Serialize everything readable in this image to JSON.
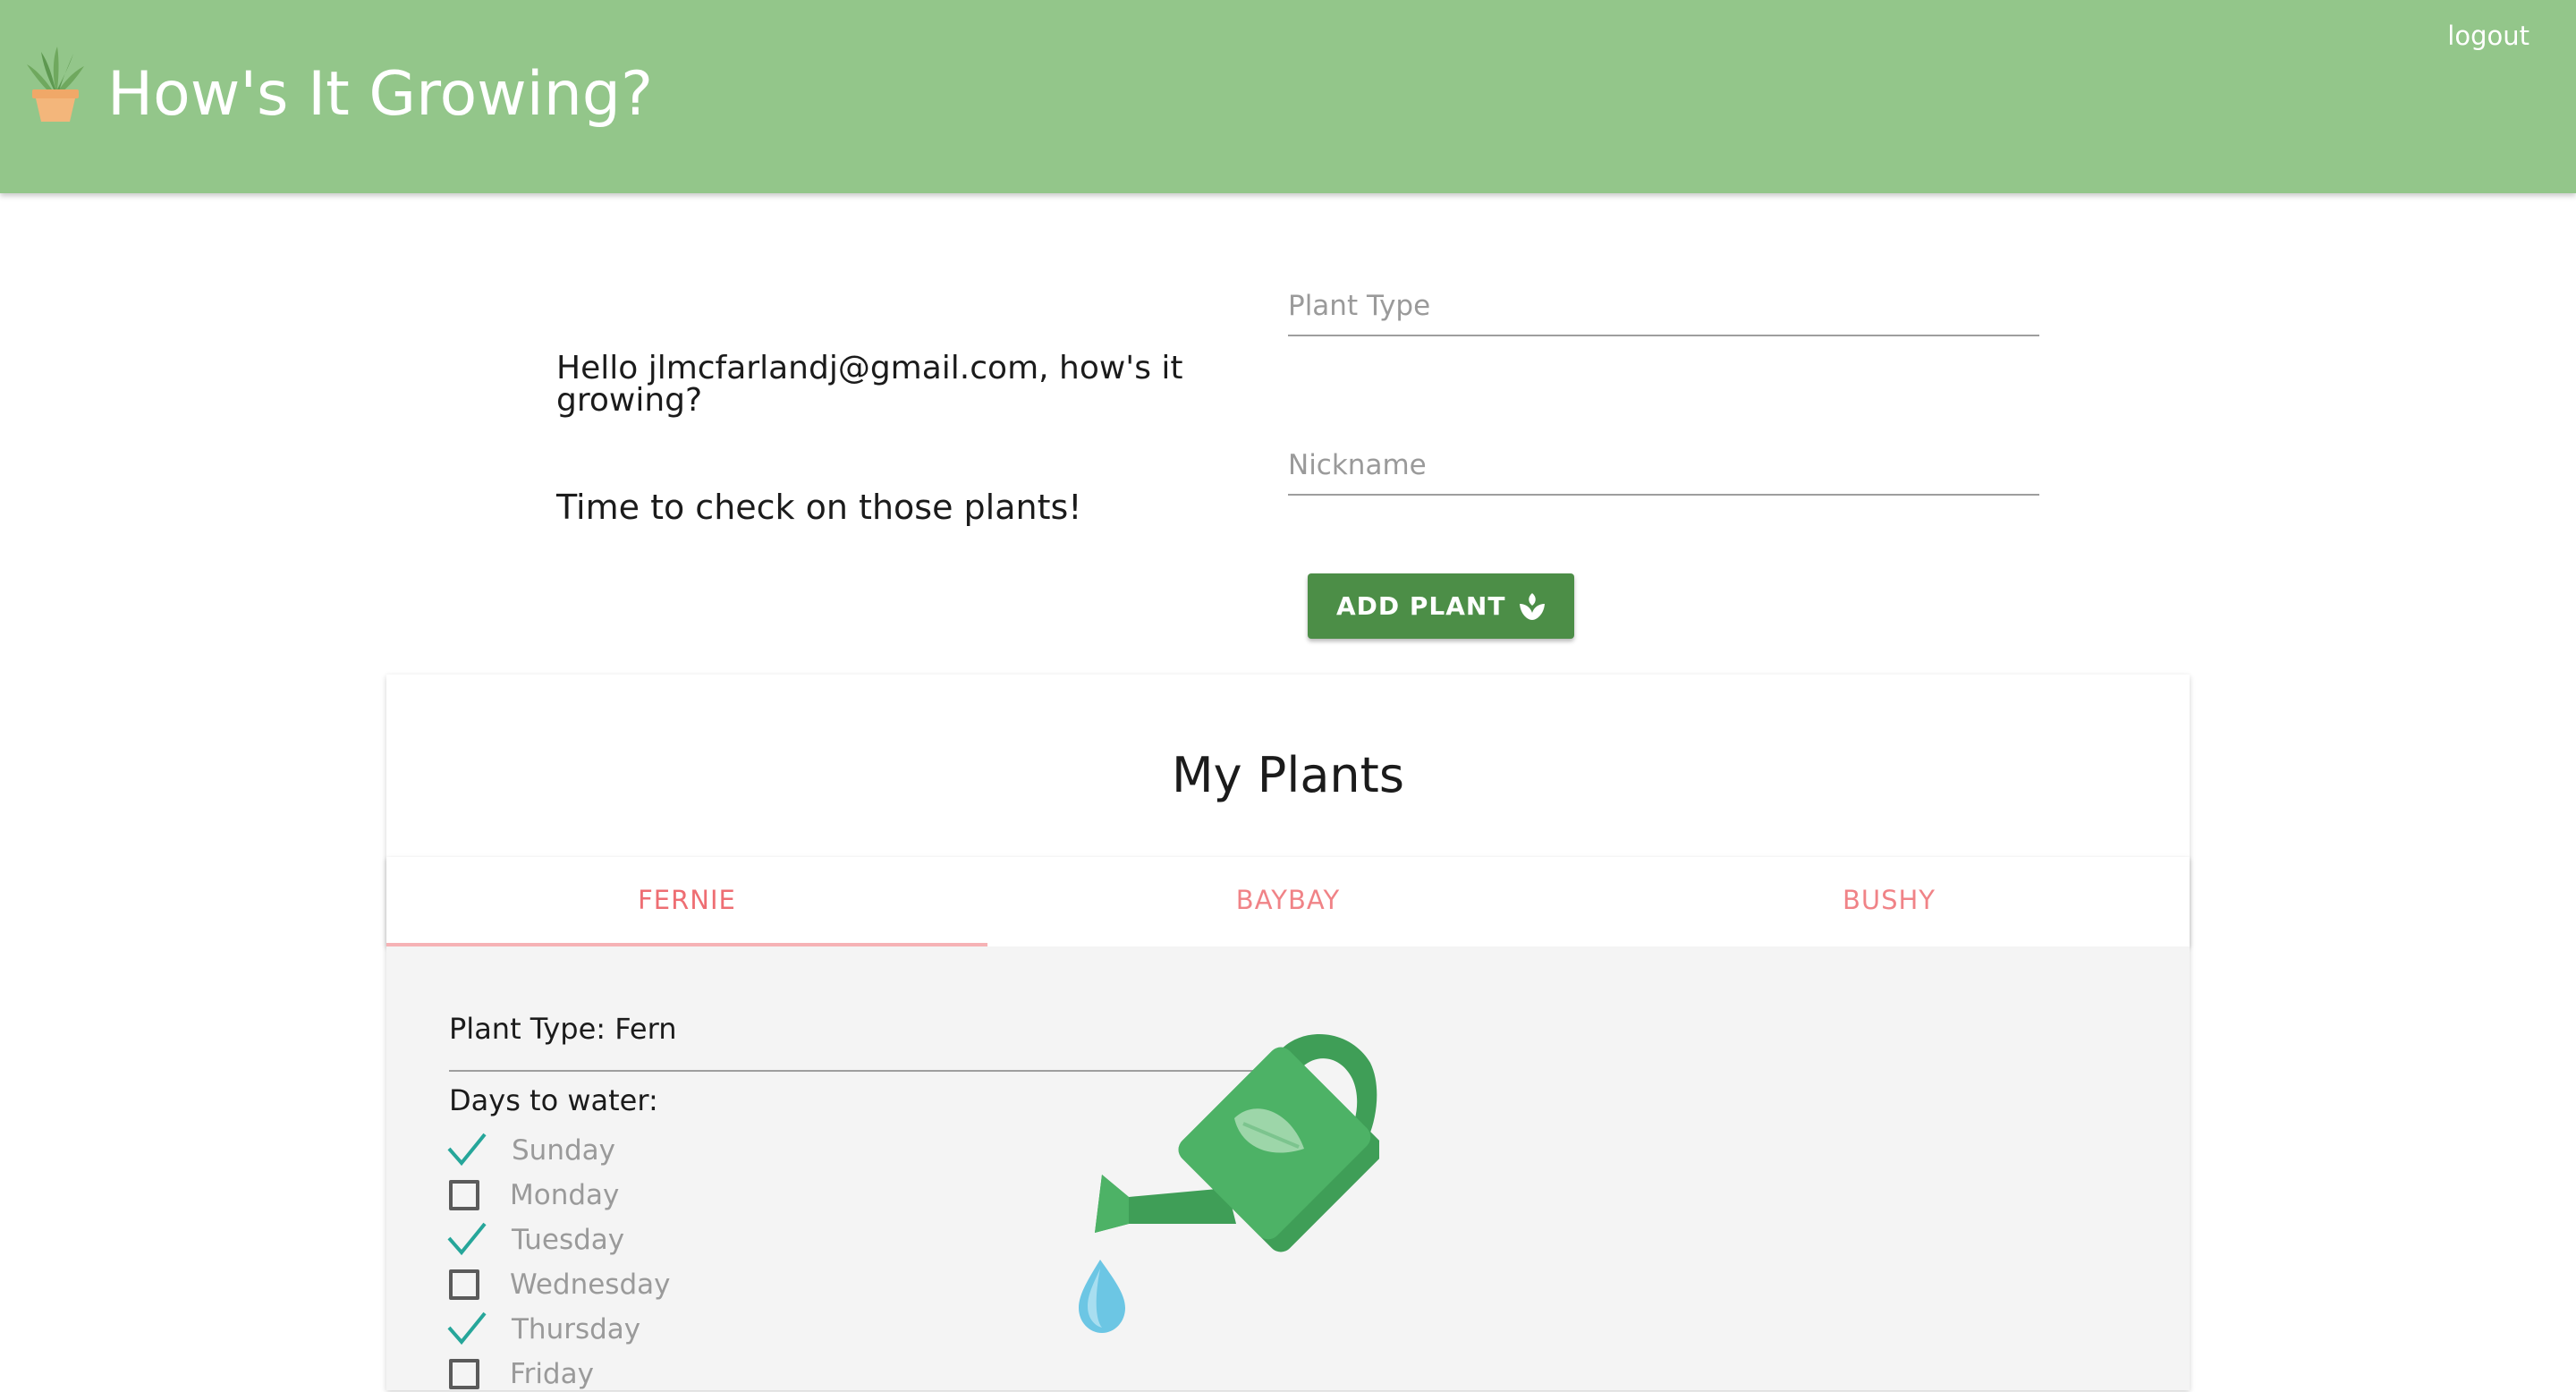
{
  "colors": {
    "header": "#93c68a",
    "button": "#4c8e47",
    "tab_text": "#ee6e73",
    "check": "#26a69a"
  },
  "header": {
    "title": "How's It Growing?",
    "logout": "logout",
    "logo_icon": "potted-plant-icon"
  },
  "greeting": {
    "hello": "Hello jlmcfarlandj@gmail.com, how's it growing?",
    "subtitle": "Time to check on those plants!"
  },
  "form": {
    "plant_type_placeholder": "Plant Type",
    "nickname_placeholder": "Nickname",
    "add_button": "ADD PLANT",
    "add_button_icon": "sprout-icon"
  },
  "plants": {
    "title": "My Plants",
    "tabs": [
      {
        "label": "FERNIE",
        "active": true
      },
      {
        "label": "BAYBAY",
        "active": false
      },
      {
        "label": "BUSHY",
        "active": false
      }
    ],
    "selected": {
      "plant_type": "Plant Type: Fern",
      "days_label": "Days to water:",
      "days": [
        {
          "label": "Sunday",
          "checked": true
        },
        {
          "label": "Monday",
          "checked": false
        },
        {
          "label": "Tuesday",
          "checked": true
        },
        {
          "label": "Wednesday",
          "checked": false
        },
        {
          "label": "Thursday",
          "checked": true
        },
        {
          "label": "Friday",
          "checked": false
        }
      ],
      "illustration": "watering-can-icon"
    }
  }
}
